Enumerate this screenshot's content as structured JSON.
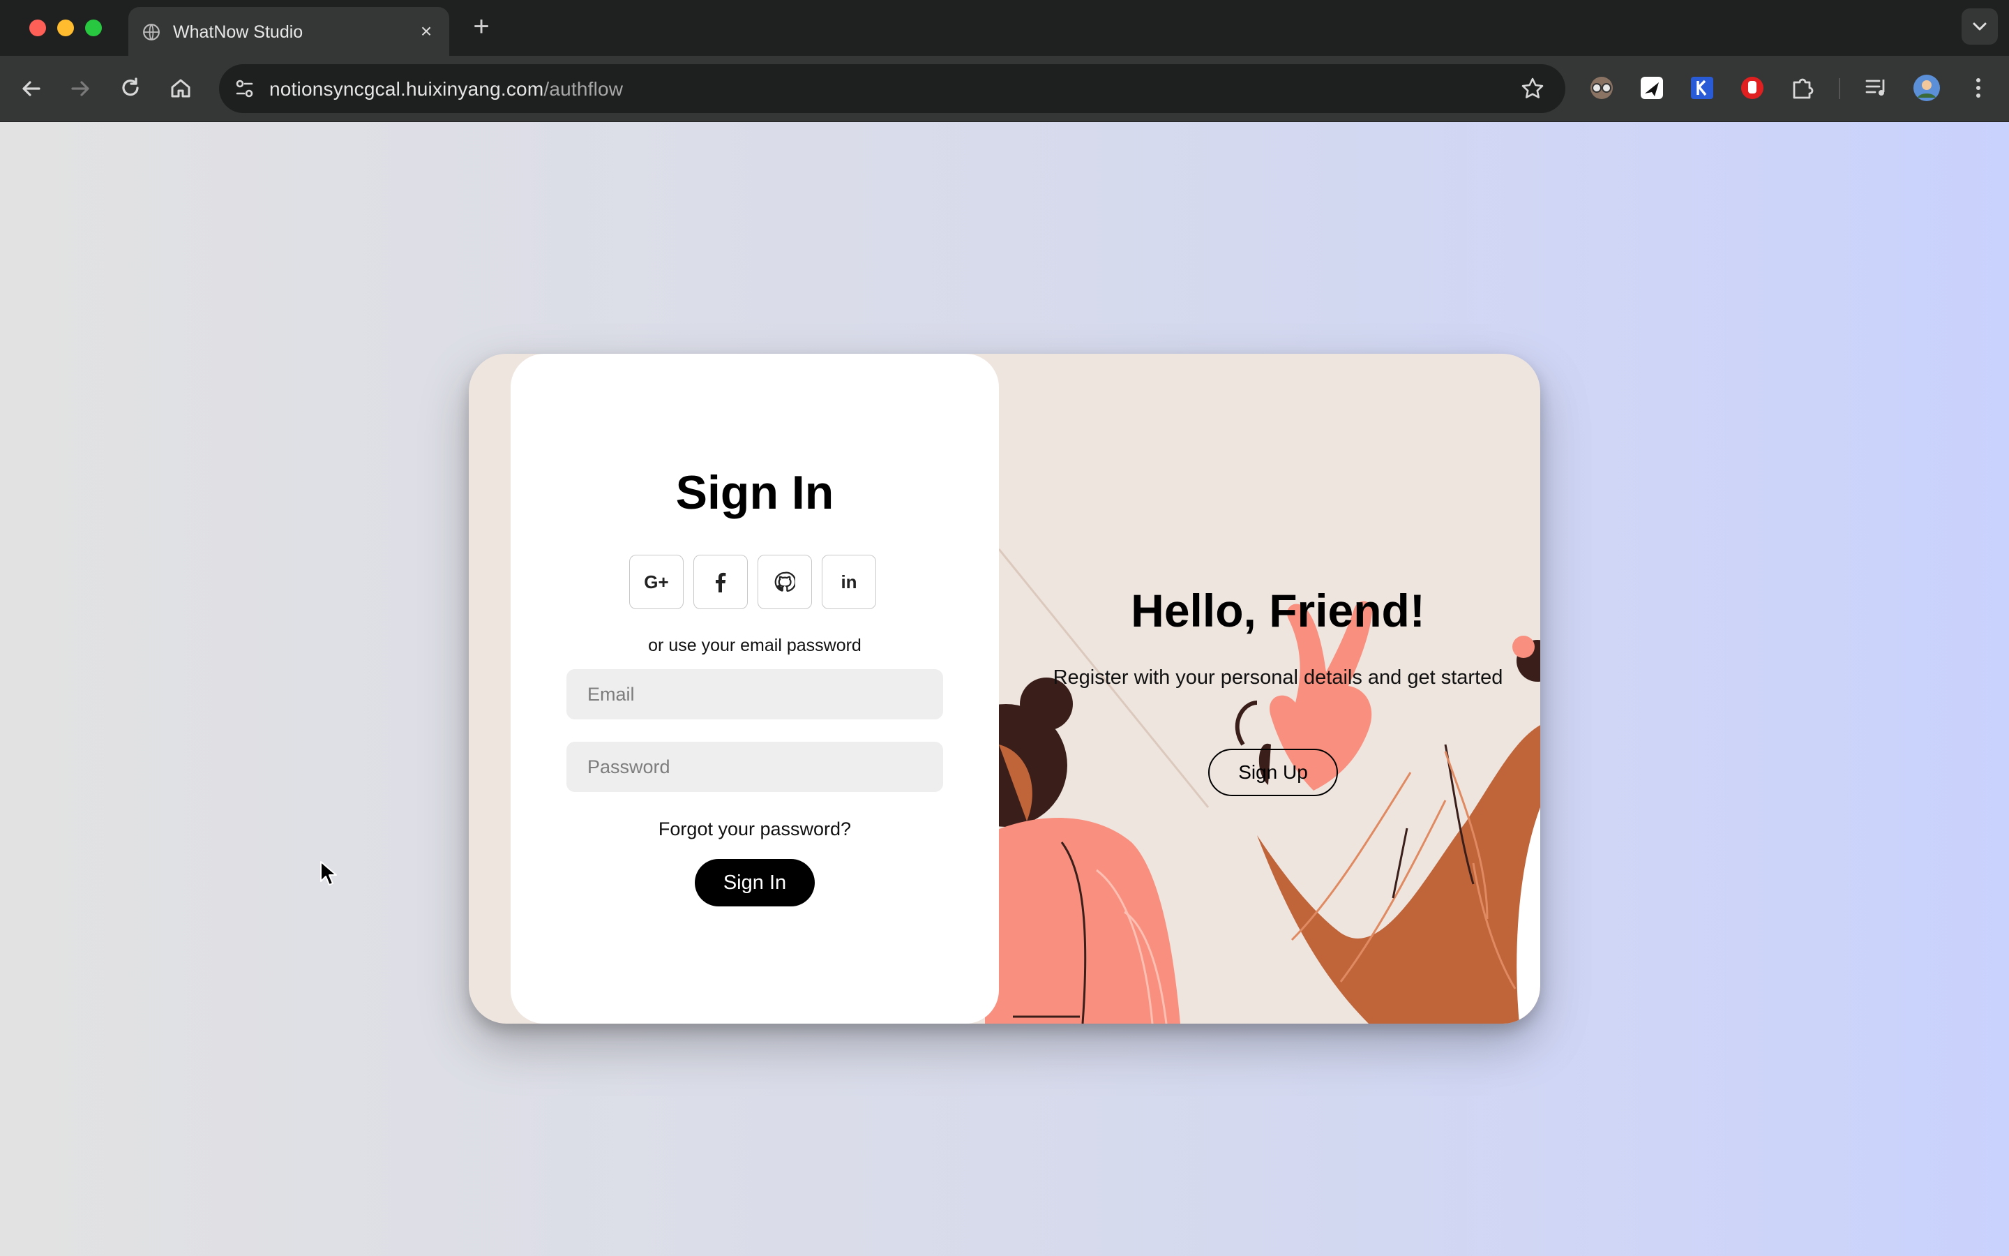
{
  "browser": {
    "tab_title": "WhatNow Studio",
    "tab_close": "×",
    "new_tab": "+",
    "url_domain": "notionsyncgcal.huixinyang.com",
    "url_path": "/authflow"
  },
  "signin": {
    "title": "Sign In",
    "social": [
      {
        "label": "G+",
        "icon": "google-plus-icon"
      },
      {
        "label": "f",
        "icon": "facebook-icon"
      },
      {
        "label": "",
        "icon": "github-icon"
      },
      {
        "label": "in",
        "icon": "linkedin-icon"
      }
    ],
    "or_text": "or use your email password",
    "email_placeholder": "Email",
    "password_placeholder": "Password",
    "forgot_text": "Forgot your password?",
    "button_label": "Sign In"
  },
  "signup_panel": {
    "title": "Hello, Friend!",
    "subtitle": "Register with your personal details and get started",
    "button_label": "Sign Up"
  },
  "colors": {
    "page_gradient_start": "#e2e2e2",
    "page_gradient_end": "#c9d2fd",
    "card_bg": "#efe5df",
    "primary_button": "#000000",
    "input_bg": "#eeeeee",
    "illustration_orange": "#c0643a",
    "illustration_pink": "#f9907f",
    "illustration_dark": "#3a1e1a"
  }
}
